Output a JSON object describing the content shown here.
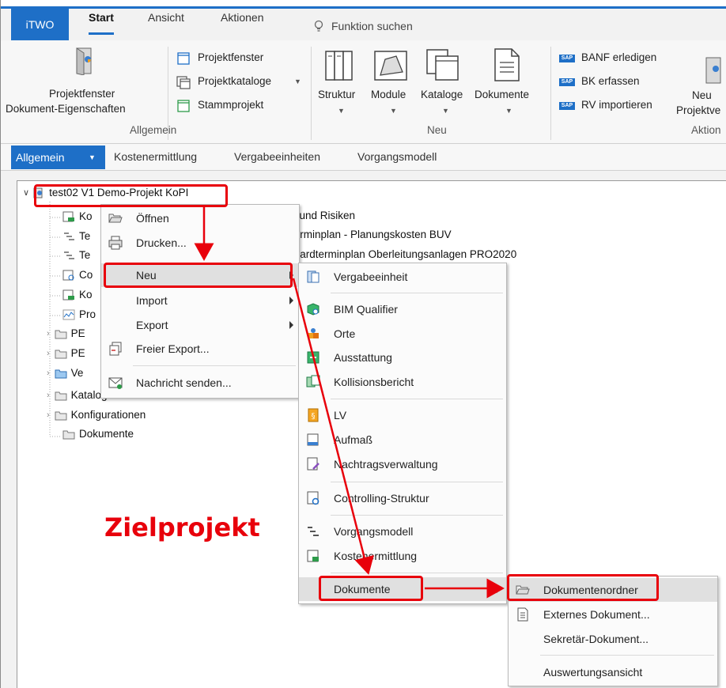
{
  "ribbon": {
    "app_tab": "iTWO",
    "tabs": [
      "Start",
      "Ansicht",
      "Aktionen"
    ],
    "search_label": "Funktion suchen",
    "groups": {
      "allgemein": {
        "label": "Allgemein",
        "big_button_line1": "Projektfenster",
        "big_button_line2": "Dokument-Eigenschaften",
        "small_buttons": [
          "Projektfenster",
          "Projektkataloge",
          "Stammprojekt"
        ]
      },
      "neu": {
        "label": "Neu",
        "buttons": [
          "Struktur",
          "Module",
          "Kataloge",
          "Dokumente"
        ]
      },
      "aktionen": {
        "label": "Aktion",
        "small_buttons": [
          "BANF erledigen",
          "BK erfassen",
          "RV importieren"
        ],
        "sap_badge": "SAP",
        "big_button_line1": "Neu",
        "big_button_line2": "Projektve"
      }
    }
  },
  "subtabs": {
    "active": "Allgemein",
    "items": [
      "Kostenermittlung",
      "Vergabeeinheiten",
      "Vorgangsmodell"
    ]
  },
  "tree": {
    "root": "test02 V1 Demo-Projekt KoPI",
    "visible_fragments": {
      "row1_prefix": "Ko",
      "row1_suffix": "cen und Risiken",
      "row2_prefix": "Te",
      "row2_suffix": "enterminplan - Planungskosten BUV",
      "row3_prefix": "Te",
      "row3_suffix": "tandardterminplan Oberleitungsanlagen PRO2020",
      "row4_prefix": "Co",
      "row5_prefix": "Ko",
      "row6_prefix": "Pro",
      "row7_prefix": "PE",
      "row8_prefix": "PE",
      "row9_prefix": "Ve",
      "row10": "Kataloge"
    },
    "items_full": [
      "Konfigurationen",
      "Dokumente"
    ]
  },
  "context_menu": {
    "items": [
      "Öffnen",
      "Drucken...",
      "Neu",
      "Import",
      "Export",
      "Freier Export...",
      "Nachricht senden..."
    ]
  },
  "submenu_neu": {
    "items": [
      "Vergabeeinheit",
      "BIM Qualifier",
      "Orte",
      "Ausstattung",
      "Kollisionsbericht",
      "LV",
      "Aufmaß",
      "Nachtragsverwaltung",
      "Controlling-Struktur",
      "Vorgangsmodell",
      "Kostenermittlung",
      "Dokumente"
    ]
  },
  "submenu_dokumente": {
    "items": [
      "Dokumentenordner",
      "Externes Dokument...",
      "Sekretär-Dokument...",
      "Auswertungsansicht"
    ]
  },
  "annotation": "Zielprojekt",
  "colors": {
    "accent_blue": "#1e6fc7",
    "highlight_red": "#e8000b",
    "menu_hover": "#e0e0e0"
  }
}
